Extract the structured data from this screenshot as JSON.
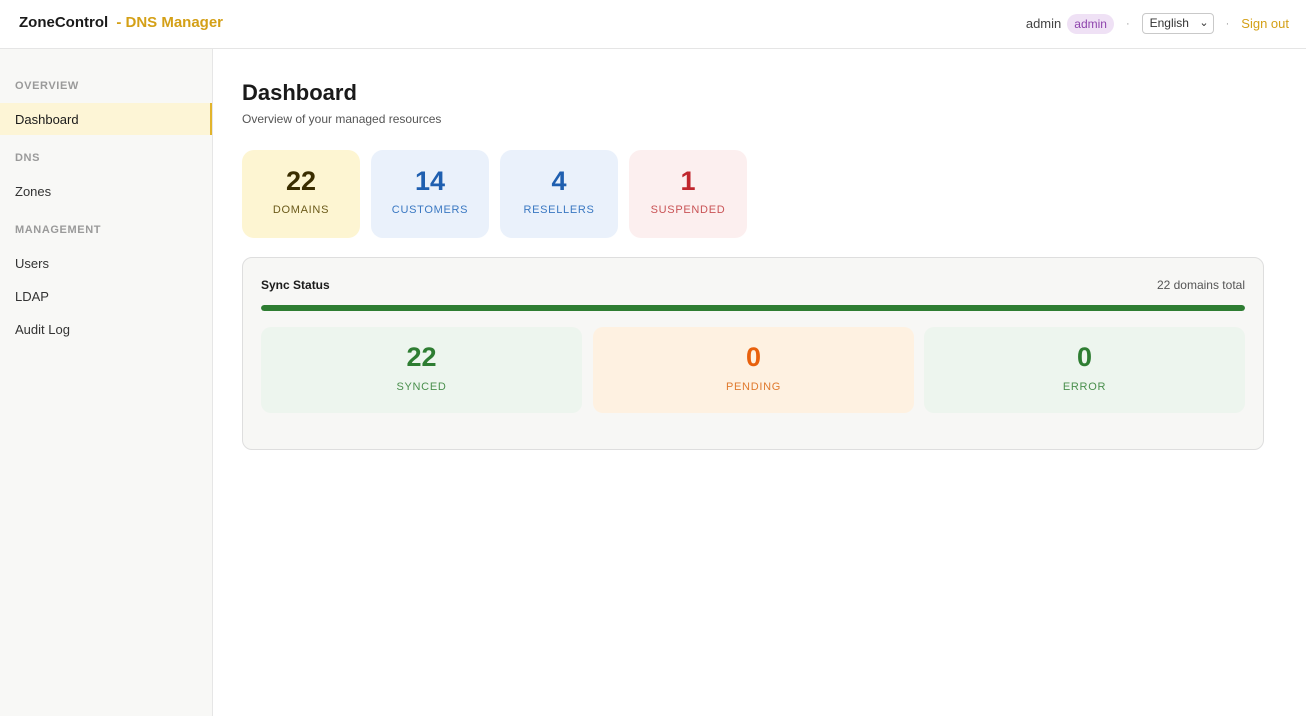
{
  "brand": {
    "name": "ZoneControl",
    "suffix": "- DNS Manager"
  },
  "header": {
    "username": "admin",
    "role_badge": "admin",
    "separator": "·",
    "language": {
      "selected": "English",
      "chevron_icon": "chevron-down-icon"
    },
    "signout_label": "Sign out"
  },
  "sidebar": {
    "sections": [
      {
        "title": "OVERVIEW",
        "items": [
          {
            "label": "Dashboard",
            "active": true
          }
        ]
      },
      {
        "title": "DNS",
        "items": [
          {
            "label": "Zones"
          }
        ]
      },
      {
        "title": "MANAGEMENT",
        "items": [
          {
            "label": "Users"
          },
          {
            "label": "LDAP"
          },
          {
            "label": "Audit Log"
          }
        ]
      }
    ]
  },
  "page": {
    "title": "Dashboard",
    "subtitle": "Overview of your managed resources"
  },
  "stats": [
    {
      "value": "22",
      "label": "DOMAINS"
    },
    {
      "value": "14",
      "label": "CUSTOMERS"
    },
    {
      "value": "4",
      "label": "RESELLERS"
    },
    {
      "value": "1",
      "label": "SUSPENDED"
    }
  ],
  "sync": {
    "title": "Sync Status",
    "total_text": "22 domains total",
    "progress_percent": 100,
    "items": [
      {
        "value": "22",
        "label": "SYNCED"
      },
      {
        "value": "0",
        "label": "PENDING"
      },
      {
        "value": "0",
        "label": "ERROR"
      }
    ]
  },
  "colors": {
    "accent": "#d4a017",
    "synced": "#2e7d32",
    "pending": "#e8600c",
    "suspended": "#c0262d",
    "info": "#1f5fb0"
  }
}
